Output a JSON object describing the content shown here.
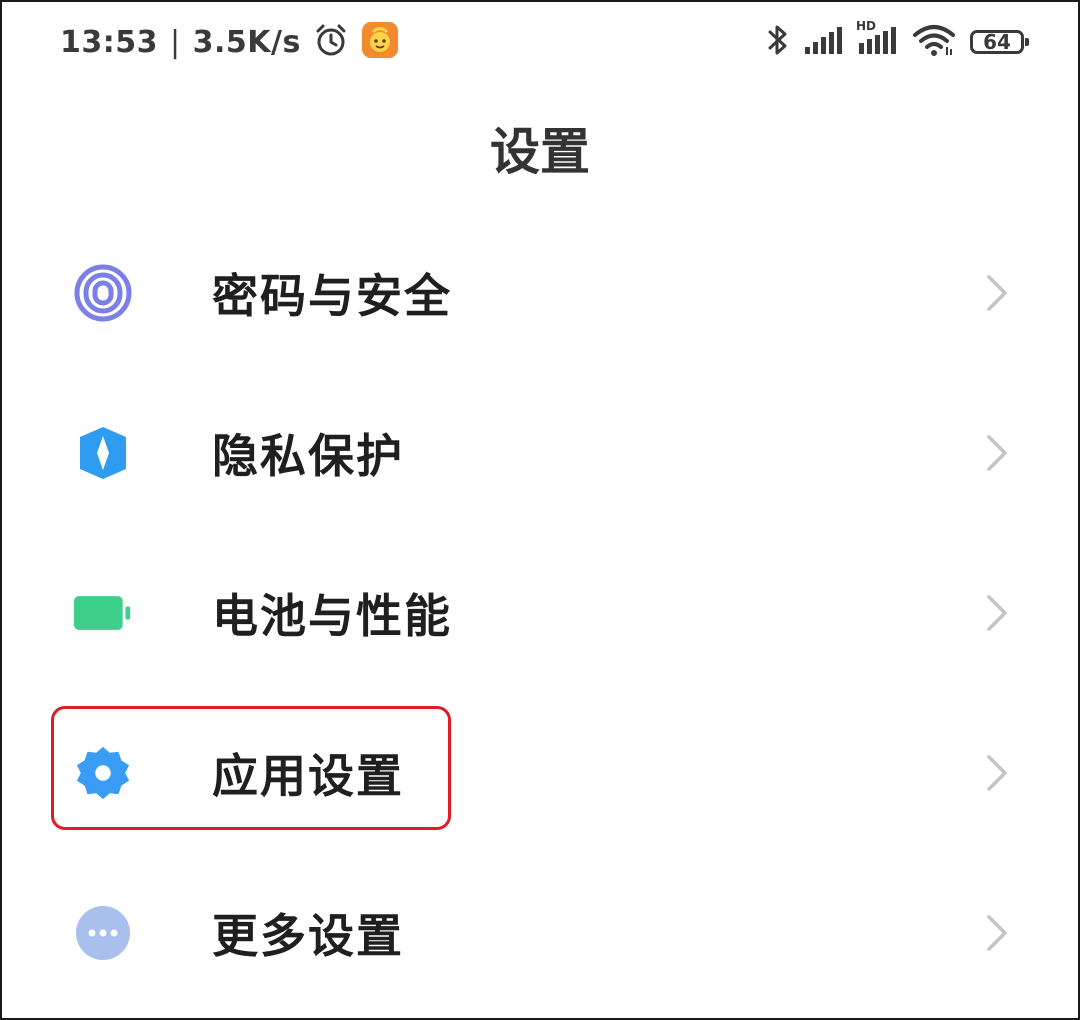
{
  "status_bar": {
    "time": "13:53",
    "separator": "|",
    "net_speed": "3.5K/s",
    "battery_level": "64",
    "icons": [
      "alarm-icon",
      "app-notification-icon",
      "bluetooth-icon",
      "signal-icon",
      "hd-signal-icon",
      "wifi-icon",
      "battery-icon"
    ],
    "hd_label": "HD"
  },
  "page": {
    "title": "设置"
  },
  "settings": {
    "items": [
      {
        "label": "密码与安全",
        "icon": "fingerprint-icon",
        "color": "#7b7fe6"
      },
      {
        "label": "隐私保护",
        "icon": "privacy-shield-icon",
        "color": "#2e9cf0"
      },
      {
        "label": "电池与性能",
        "icon": "battery-icon",
        "color": "#3ed08a"
      },
      {
        "label": "应用设置",
        "icon": "gear-icon",
        "color": "#3a9cf5"
      },
      {
        "label": "更多设置",
        "icon": "more-icon",
        "color": "#a9c0ef"
      }
    ]
  },
  "highlight_color": "#e01b24"
}
